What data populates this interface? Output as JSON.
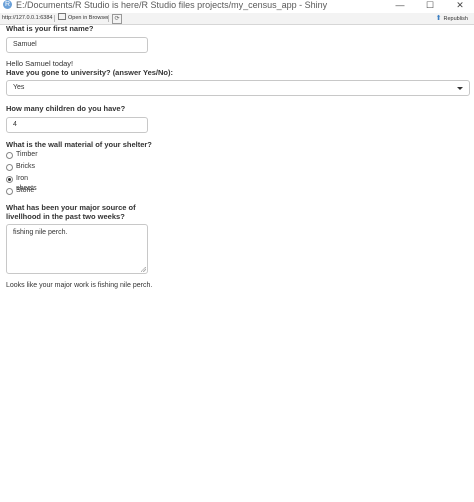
{
  "window": {
    "title": "E:/Documents/R Studio is here/R Studio files projects/my_census_app - Shiny",
    "controls": [
      "—",
      "☐",
      "✕"
    ]
  },
  "toolbar": {
    "url": "http://127.0.0.1:6384",
    "open_in_browser": "Open in Browser",
    "republish": "Republish"
  },
  "form": {
    "first_name_label": "What is your first name?",
    "first_name_value": "Samuel",
    "greeting": "Hello Samuel today!",
    "university_label": "Have you gone to university? (answer Yes/No):",
    "university_value": "Yes",
    "children_label": "How many children do you have?",
    "children_value": "4",
    "wall_label": "What is the wall material of your shelter?",
    "wall_options": [
      {
        "label": "Timber",
        "checked": false
      },
      {
        "label": "Bricks",
        "checked": false
      },
      {
        "label": "Iron sheets",
        "checked": true
      },
      {
        "label": "Stone",
        "checked": false
      }
    ],
    "livelihood_label_line1": "What has been your major source of",
    "livelihood_label_line2": "livellhood in the past two weeks?",
    "livelihood_value": "fishing nile perch.",
    "result_text": "Looks like your major work is fishing nile perch."
  }
}
